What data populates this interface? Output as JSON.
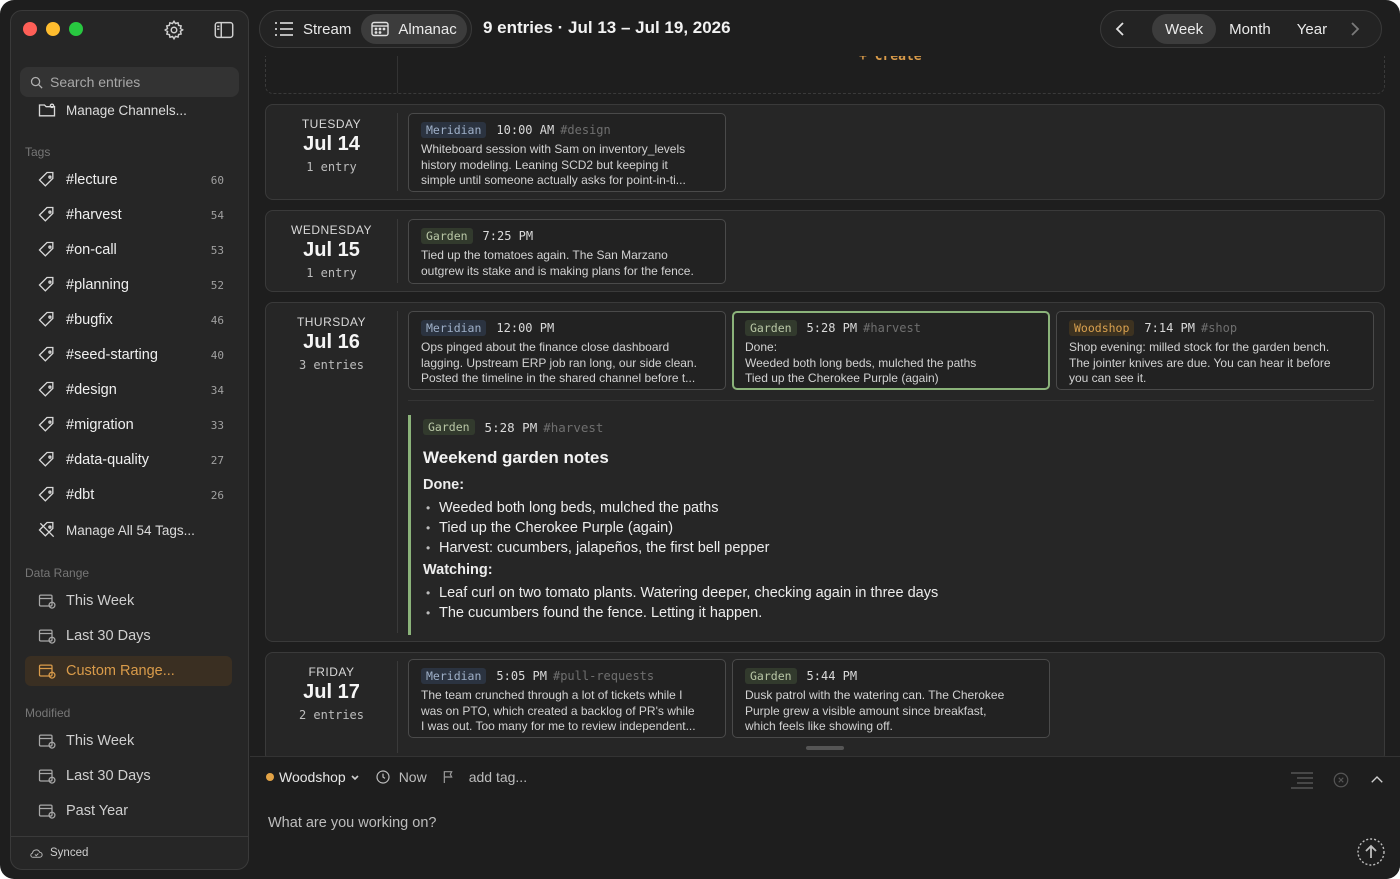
{
  "sidebar": {
    "search_placeholder": "Search entries",
    "manage_channels": "Manage Channels...",
    "tags_heading": "Tags",
    "tags": [
      {
        "label": "#lecture",
        "count": "60"
      },
      {
        "label": "#harvest",
        "count": "54"
      },
      {
        "label": "#on-call",
        "count": "53"
      },
      {
        "label": "#planning",
        "count": "52"
      },
      {
        "label": "#bugfix",
        "count": "46"
      },
      {
        "label": "#seed-starting",
        "count": "40"
      },
      {
        "label": "#design",
        "count": "34"
      },
      {
        "label": "#migration",
        "count": "33"
      },
      {
        "label": "#data-quality",
        "count": "27"
      },
      {
        "label": "#dbt",
        "count": "26"
      }
    ],
    "manage_tags": "Manage All 54 Tags...",
    "date_range_heading": "Data Range",
    "date_range": [
      "This Week",
      "Last 30 Days",
      "Custom Range..."
    ],
    "modified_heading": "Modified",
    "modified": [
      "This Week",
      "Last 30 Days",
      "Past Year"
    ],
    "sync_status": "Synced",
    "accent": "#d99b4a"
  },
  "topbar": {
    "views": [
      "Stream",
      "Almanac"
    ],
    "title": "9 entries · Jul 13 – Jul 19, 2026",
    "periods": [
      "Week",
      "Month",
      "Year"
    ]
  },
  "create_label": "+ Create",
  "days": [
    {
      "name": "TUESDAY",
      "date": "Jul 14",
      "count": "1 entry",
      "entries": [
        {
          "channel": "Meridian",
          "time": "10:00 AM",
          "tag": "#design",
          "lines": [
            "Whiteboard session with Sam on inventory_levels",
            "history modeling. Leaning SCD2 but keeping it",
            "simple until someone actually asks for point-in-ti..."
          ]
        }
      ]
    },
    {
      "name": "WEDNESDAY",
      "date": "Jul 15",
      "count": "1 entry",
      "entries": [
        {
          "channel": "Garden",
          "time": "7:25 PM",
          "tag": "",
          "lines": [
            "Tied up the tomatoes again. The San Marzano",
            "outgrew its stake and is making plans for the fence."
          ]
        }
      ]
    },
    {
      "name": "THURSDAY",
      "date": "Jul 16",
      "count": "3 entries",
      "entries": [
        {
          "channel": "Meridian",
          "time": "12:00 PM",
          "tag": "",
          "lines": [
            "Ops pinged about the finance close dashboard",
            "lagging. Upstream ERP job ran long, our side clean.",
            "Posted the timeline in the shared channel before t..."
          ]
        },
        {
          "channel": "Garden",
          "time": "5:28 PM",
          "tag": "#harvest",
          "lines": [
            "Done:",
            "Weeded both long beds, mulched the paths",
            "Tied up the Cherokee Purple (again)"
          ]
        },
        {
          "channel": "Woodshop",
          "time": "7:14 PM",
          "tag": "#shop",
          "lines": [
            "Shop evening: milled stock for the garden bench.",
            "The jointer knives are due. You can hear it before",
            "you can see it."
          ]
        }
      ],
      "expanded": {
        "channel": "Garden",
        "time": "5:28 PM",
        "tag": "#harvest",
        "title": "Weekend garden notes",
        "done_heading": "Done:",
        "done": [
          "Weeded both long beds, mulched the paths",
          "Tied up the Cherokee Purple (again)",
          "Harvest: cucumbers, jalapeños, the first bell pepper"
        ],
        "watching_heading": "Watching:",
        "watching": [
          "Leaf curl on two tomato plants. Watering deeper, checking again in three days",
          "The cucumbers found the fence. Letting it happen."
        ]
      }
    },
    {
      "name": "FRIDAY",
      "date": "Jul 17",
      "count": "2 entries",
      "entries": [
        {
          "channel": "Meridian",
          "time": "5:05 PM",
          "tag": "#pull-requests",
          "lines": [
            "The team crunched through a lot of tickets while I",
            "was on PTO, which created a backlog of PR's while",
            "I was out. Too many for me to review independent..."
          ]
        },
        {
          "channel": "Garden",
          "time": "5:44 PM",
          "tag": "",
          "lines": [
            "Dusk patrol with the watering can. The Cherokee",
            "Purple grew a visible amount since breakfast,",
            "which feels like showing off."
          ]
        }
      ]
    }
  ],
  "composer": {
    "channel": "Woodshop",
    "channel_color": "#e3a346",
    "when": "Now",
    "tag_placeholder": "add tag...",
    "placeholder": "What are you working on?"
  },
  "selection_color": "#8bb37a"
}
